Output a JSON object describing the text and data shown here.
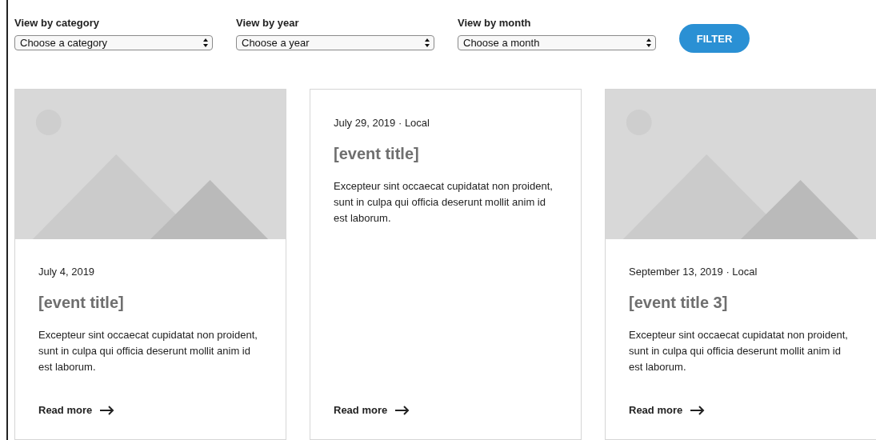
{
  "filters": [
    {
      "label": "View by category",
      "value": "Choose a category"
    },
    {
      "label": "View by year",
      "value": "Choose a year"
    },
    {
      "label": "View by month",
      "value": "Choose a month"
    }
  ],
  "filter_button": "FILTER",
  "cards": [
    {
      "picture": true,
      "date": "July 4, 2019",
      "title": "[event title]",
      "text": "Excepteur sint occaecat cupidatat non proident, sunt in culpa qui officia deserunt mollit anim id est laborum.",
      "link": "Read more"
    },
    {
      "picture": false,
      "date": "July 29, 2019 · Local",
      "title": "[event title]",
      "text": "Excepteur sint occaecat cupidatat non proident, sunt in culpa qui officia deserunt mollit anim id est laborum.",
      "link": "Read more"
    },
    {
      "picture": true,
      "date": "September 13, 2019 · Local",
      "title": "[event title 3]",
      "text": "Excepteur sint occaecat cupidatat non proident, sunt in culpa qui officia deserunt mollit anim id est laborum.",
      "link": "Read more"
    }
  ]
}
